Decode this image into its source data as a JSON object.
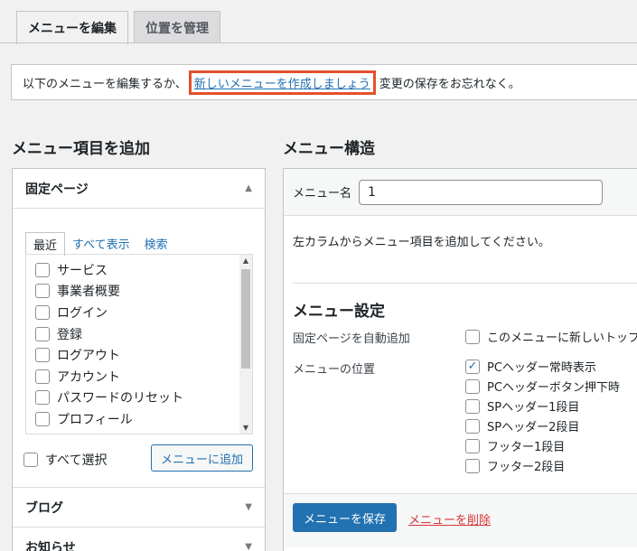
{
  "tabs": {
    "edit": "メニューを編集",
    "locations": "位置を管理"
  },
  "notice": {
    "prefix": "以下のメニューを編集するか、",
    "link": "新しいメニューを作成しましょう",
    "suffix": "変更の保存をお忘れなく。"
  },
  "left": {
    "title": "メニュー項目を追加",
    "accordion_open": "固定ページ",
    "inner_tabs": [
      "最近",
      "すべて表示",
      "検索"
    ],
    "pages": [
      "サービス",
      "事業者概要",
      "ログイン",
      "登録",
      "ログアウト",
      "アカウント",
      "パスワードのリセット",
      "プロフィール"
    ],
    "select_all": "すべて選択",
    "add_button": "メニューに追加",
    "accordion_blog": "ブログ",
    "accordion_news": "お知らせ"
  },
  "right": {
    "title": "メニュー構造",
    "name_label": "メニュー名",
    "name_value": "1",
    "hint": "左カラムからメニュー項目を追加してください。",
    "settings_title": "メニュー設定",
    "auto_add_label": "固定ページを自動追加",
    "auto_add_option": "このメニューに新しいトップ",
    "location_label": "メニューの位置",
    "locations": [
      {
        "label": "PCヘッダー常時表示",
        "checked": true
      },
      {
        "label": "PCヘッダーボタン押下時",
        "checked": false
      },
      {
        "label": "SPヘッダー1段目",
        "checked": false
      },
      {
        "label": "SPヘッダー2段目",
        "checked": false
      },
      {
        "label": "フッター1段目",
        "checked": false
      },
      {
        "label": "フッター2段目",
        "checked": false
      }
    ],
    "save_button": "メニューを保存",
    "delete_link": "メニューを削除"
  }
}
